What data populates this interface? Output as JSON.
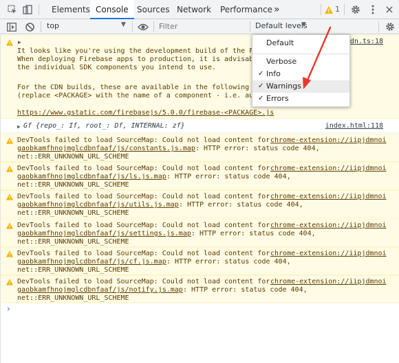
{
  "tabs": {
    "elements": "Elements",
    "console": "Console",
    "sources": "Sources",
    "network": "Network",
    "performance": "Performance",
    "more": "»",
    "warning_count": "1"
  },
  "toolbar": {
    "context": "top",
    "filter_placeholder": "Filter",
    "levels": "Default levels"
  },
  "dropdown": {
    "default": "Default",
    "verbose": "Verbose",
    "info": "Info",
    "warnings": "Warnings",
    "errors": "Errors",
    "check": "✓"
  },
  "messages": {
    "firebase": {
      "line1": "It looks like you're using the development build of the F",
      "line2": "When deploying Firebase apps to production, it is advisab",
      "line3": "the individual SDK components you intend to use.",
      "line4": "For the CDN builds, these are available in the following ",
      "line5": "(replace <PACKAGE> with the name of a component - i.e. au",
      "link": "https://www.gstatic.com/firebasejs/5.0.0/firebase-<PACKAGE>.js",
      "source": "dn.ts:18"
    },
    "object": {
      "text": "Gf {repo_: If, root_: Df, INTERNAL: zf}",
      "source": "index.html:118"
    },
    "sourcemaps": [
      {
        "line1": "DevTools failed to load SourceMap: Could not load content for ",
        "link1": "chrome-extension://iipjdmnoi",
        "link2": "gaobkamfhnojmglcdbnfaaf/js/constants.js.map",
        "rest": ": HTTP error: status code 404,",
        "line3": "net::ERR_UNKNOWN_URL_SCHEME"
      },
      {
        "line1": "DevTools failed to load SourceMap: Could not load content for ",
        "link1": "chrome-extension://iipjdmnoi",
        "link2": "gaobkamfhnojmglcdbnfaaf/js/ls.js.map",
        "rest": ": HTTP error: status code 404,",
        "line3": "net::ERR_UNKNOWN_URL_SCHEME"
      },
      {
        "line1": "DevTools failed to load SourceMap: Could not load content for ",
        "link1": "chrome-extension://iipjdmnoi",
        "link2": "gaobkamfhnojmglcdbnfaaf/js/utils.js.map",
        "rest": ": HTTP error: status code 404,",
        "line3": "net::ERR_UNKNOWN_URL_SCHEME"
      },
      {
        "line1": "DevTools failed to load SourceMap: Could not load content for ",
        "link1": "chrome-extension://iipjdmnoi",
        "link2": "gaobkamfhnojmglcdbnfaaf/js/settings.js.map",
        "rest": ": HTTP error: status code 404,",
        "line3": "net::ERR_UNKNOWN_URL_SCHEME"
      },
      {
        "line1": "DevTools failed to load SourceMap: Could not load content for ",
        "link1": "chrome-extension://iipjdmnoi",
        "link2": "gaobkamfhnojmglcdbnfaaf/js/cf.js.map",
        "rest": ": HTTP error: status code 404,",
        "line3": "net::ERR_UNKNOWN_URL_SCHEME"
      },
      {
        "line1": "DevTools failed to load SourceMap: Could not load content for ",
        "link1": "chrome-extension://iipjdmnoi",
        "link2": "gaobkamfhnojmglcdbnfaaf/js/notify.js.map",
        "rest": ": HTTP error: status code 404,",
        "line3": "net::ERR_UNKNOWN_URL_SCHEME"
      }
    ]
  },
  "colors": {
    "warning_bg": "#fffbe5",
    "warning_text": "#5c3c00",
    "accent": "#1a73e8",
    "arrow": "#e8362c"
  },
  "icons": [
    "inspect-icon",
    "device-toggle-icon",
    "warning-icon",
    "gear-icon",
    "kebab-menu-icon",
    "sidebar-toggle-icon",
    "clear-console-icon",
    "eye-icon",
    "console-settings-icon",
    "expand-triangle-icon",
    "prompt-chevron-icon"
  ]
}
